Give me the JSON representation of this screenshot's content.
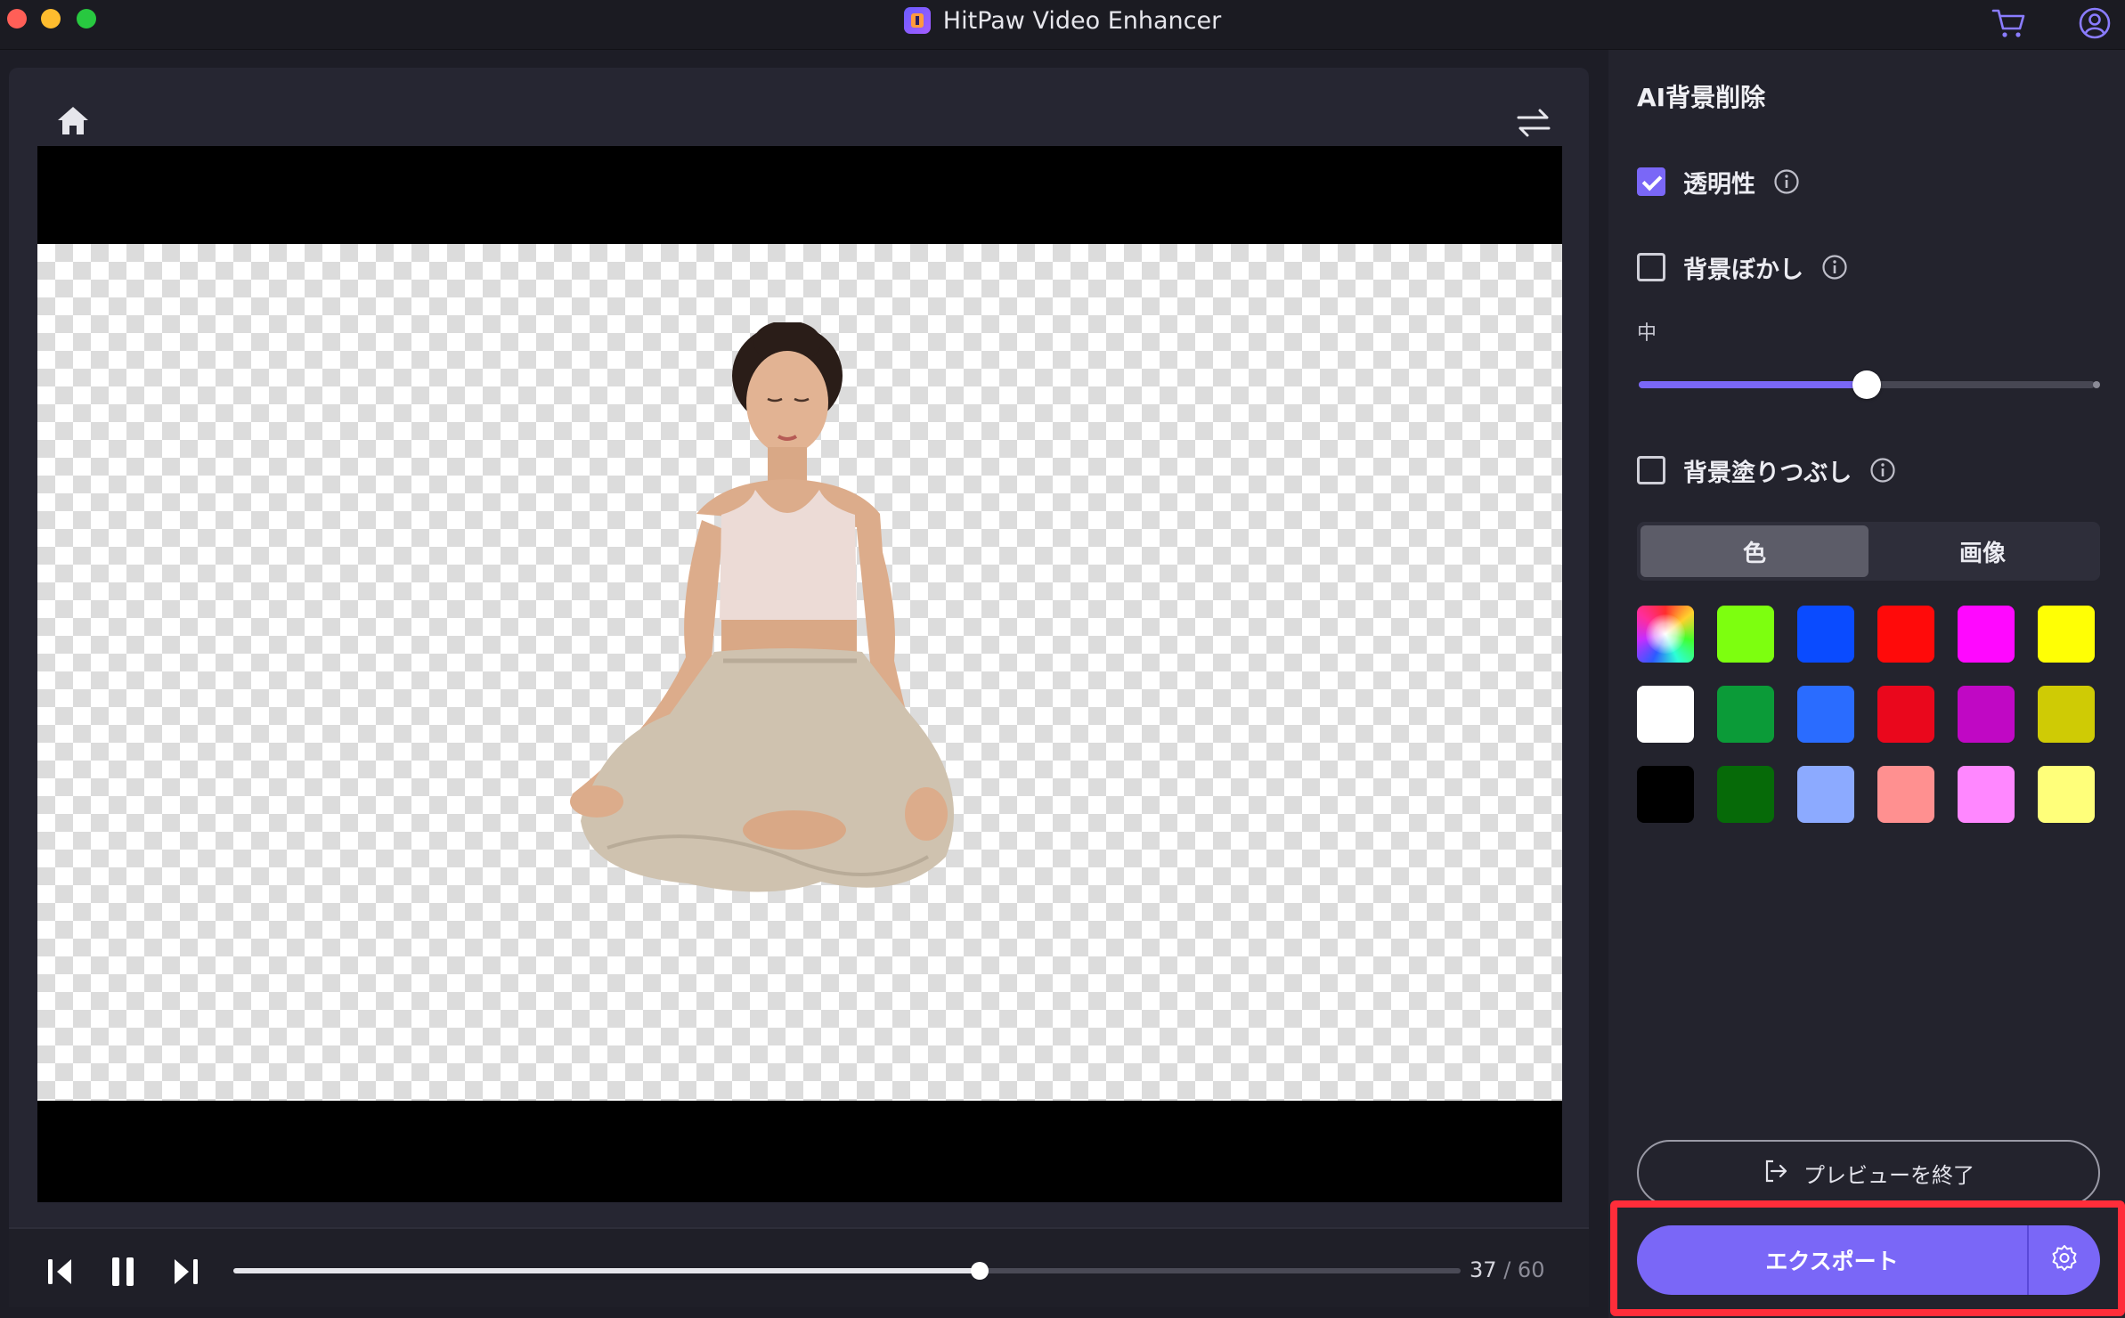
{
  "window": {
    "title": "HitPaw Video Enhancer"
  },
  "playback": {
    "current_frame": "37",
    "separator": "/",
    "total_frames": "60",
    "progress_fraction": 0.608
  },
  "sidebar": {
    "title": "AI背景削除",
    "options": [
      {
        "label": "透明性",
        "checked": true
      },
      {
        "label": "背景ぼかし",
        "checked": false
      },
      {
        "label": "背景塗りつぶし",
        "checked": false
      }
    ],
    "blur_level_label": "中",
    "blur_level_fraction": 0.5,
    "fill_tabs": [
      {
        "label": "色",
        "active": true
      },
      {
        "label": "画像",
        "active": false
      }
    ],
    "swatches": [
      "rainbow",
      "#7dff0f",
      "#0a4bff",
      "#ff0a0a",
      "#ff08ff",
      "#ffff05",
      "#ffffff",
      "#0b9b38",
      "#2a6cff",
      "#ea071c",
      "#c008c4",
      "#cfcb05",
      "#000000",
      "#066a08",
      "#8caaff",
      "#ff9090",
      "#ff87ff",
      "#ffff7a"
    ],
    "end_preview_label": "プレビューを終了",
    "export_label": "エクスポート"
  },
  "colors": {
    "accent": "#7a67f7",
    "highlight": "#ff2d3a"
  }
}
